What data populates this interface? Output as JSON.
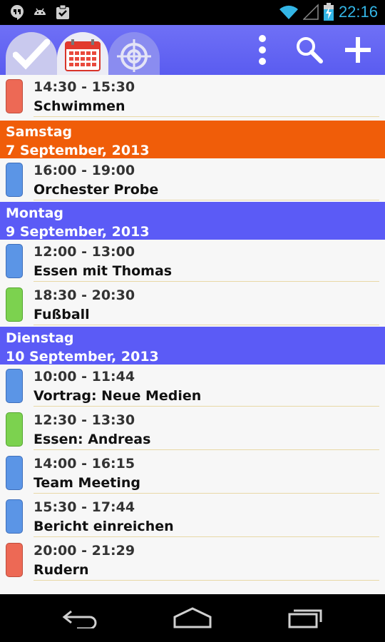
{
  "status_bar": {
    "time": "22:16",
    "left_icons": [
      "hangouts-icon",
      "android-icon",
      "clipboard-check-icon"
    ],
    "right_icons": [
      "wifi-icon",
      "signal-icon",
      "battery-charging-icon"
    ],
    "time_color": "#33b5e5"
  },
  "action_bar": {
    "background": "#5a5cf0",
    "tabs": [
      {
        "name": "tasks",
        "icon": "checkmark-icon"
      },
      {
        "name": "calendar",
        "icon": "calendar-icon",
        "selected": true
      },
      {
        "name": "target",
        "icon": "target-icon"
      }
    ],
    "actions": [
      "overflow-menu-icon",
      "search-icon",
      "add-icon"
    ]
  },
  "agenda": {
    "first_event": {
      "time": "14:30 - 15:30",
      "title": "Schwimmen",
      "color": "red"
    },
    "days": [
      {
        "weekday": "Samstag",
        "date": "7 September, 2013",
        "color": "#f05d09",
        "events": [
          {
            "time": "16:00 - 19:00",
            "title": "Orchester Probe",
            "color": "blue"
          }
        ]
      },
      {
        "weekday": "Montag",
        "date": "9 September, 2013",
        "color": "#5b5bf6",
        "events": [
          {
            "time": "12:00 - 13:00",
            "title": "Essen mit Thomas",
            "color": "blue"
          },
          {
            "time": "18:30 - 20:30",
            "title": "Fußball",
            "color": "green"
          }
        ]
      },
      {
        "weekday": "Dienstag",
        "date": "10 September, 2013",
        "color": "#5b5bf6",
        "events": [
          {
            "time": "10:00 - 11:44",
            "title": "Vortrag: Neue Medien",
            "color": "blue"
          },
          {
            "time": "12:30 - 13:30",
            "title": "Essen: Andreas",
            "color": "green"
          },
          {
            "time": "14:00 - 16:15",
            "title": "Team Meeting",
            "color": "blue"
          },
          {
            "time": "15:30 - 17:44",
            "title": "Bericht einreichen",
            "color": "blue"
          },
          {
            "time": "20:00 - 21:29",
            "title": "Rudern",
            "color": "red"
          }
        ]
      }
    ]
  },
  "nav_bar": {
    "buttons": [
      "back-icon",
      "home-icon",
      "recent-apps-icon"
    ]
  }
}
